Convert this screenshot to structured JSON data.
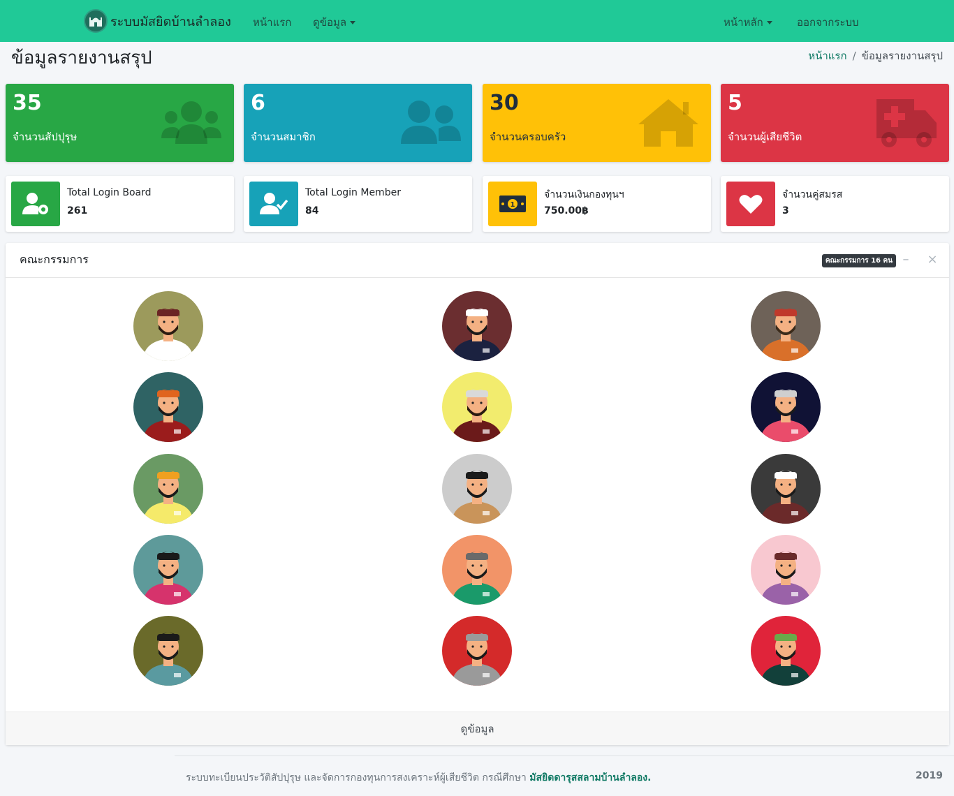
{
  "navbar": {
    "brand": "ระบบมัสยิดบ้านลำลอง",
    "links": [
      "หน้าแรก",
      "ดูข้อมูล"
    ],
    "right_links": [
      "หน้าหลัก",
      "ออกจากระบบ"
    ]
  },
  "page": {
    "title": "ข้อมูลรายงานสรุป",
    "breadcrumb": [
      "หน้าแรก",
      "ข้อมูลรายงานสรุป"
    ]
  },
  "small_boxes": [
    {
      "value": "35",
      "label": "จำนวนสัปปุรุษ",
      "color": "#28a745",
      "icon": "users-icon"
    },
    {
      "value": "6",
      "label": "จำนวนสมาชิก",
      "color": "#17a2b8",
      "icon": "user-friends-icon"
    },
    {
      "value": "30",
      "label": "จำนวนครอบครัว",
      "color": "#ffc107",
      "icon": "home-icon"
    },
    {
      "value": "5",
      "label": "จำนวนผู้เสียชีวิต",
      "color": "#dc3545",
      "icon": "ambulance-icon"
    }
  ],
  "info_boxes": [
    {
      "label": "Total Login Board",
      "value": "261",
      "color": "#28a745",
      "icon": "user-cog-icon"
    },
    {
      "label": "Total Login Member",
      "value": "84",
      "color": "#17a2b8",
      "icon": "user-check-icon"
    },
    {
      "label": "จำนวนเงินกองทุนฯ",
      "value": "750.00฿",
      "color": "#ffc107",
      "icon": "money-bill-icon"
    },
    {
      "label": "จำนวนคู่สมรส",
      "value": "3",
      "color": "#dc3545",
      "icon": "heart-icon"
    }
  ],
  "committee": {
    "title": "คณะกรรมการ",
    "badge": "คณะกรรมการ 16 คน",
    "footer_link": "ดูข้อมูล",
    "avatars": [
      {
        "bg": "#9c9a5c",
        "shirt": "#ffffff",
        "hat": "#6b2424",
        "hair": "#2a1a10"
      },
      {
        "bg": "#6b2e30",
        "shirt": "#1b2240",
        "hat": "#ffffff",
        "hair": "#1a1a1a"
      },
      {
        "bg": "#6e6258",
        "shirt": "#d9702a",
        "hat": "#c0392b",
        "hair": "#3a2a1a"
      },
      {
        "bg": "#2f6364",
        "shirt": "#9b1c1c",
        "hat": "#e0641e",
        "hair": "#1a1a1a"
      },
      {
        "bg": "#f2ec6e",
        "shirt": "#6b1a1a",
        "hat": "#d9d9d9",
        "hair": "#2a1a10"
      },
      {
        "bg": "#101235",
        "shirt": "#ea4c6b",
        "hat": "#cfcfcf",
        "hair": "#1a1a1a"
      },
      {
        "bg": "#6a9a64",
        "shirt": "#f5ea6a",
        "hat": "#f0a020",
        "hair": "#1a1a1a"
      },
      {
        "bg": "#cccccc",
        "shirt": "#c9945a",
        "hat": "#1a1a1a",
        "hair": "#1a1a1a"
      },
      {
        "bg": "#3a3a3a",
        "shirt": "#6b2a2a",
        "hat": "#ffffff",
        "hair": "#1a1a1a"
      },
      {
        "bg": "#5e9a9a",
        "shirt": "#d6336c",
        "hat": "#1a1a1a",
        "hair": "#1a1a1a"
      },
      {
        "bg": "#f29468",
        "shirt": "#1a9a6a",
        "hat": "#6a6a6a",
        "hair": "#1a1a1a"
      },
      {
        "bg": "#f8c8d0",
        "shirt": "#9a62a8",
        "hat": "#6a2a2a",
        "hair": "#1a1a1a"
      },
      {
        "bg": "#6a6a2a",
        "shirt": "#5a9aa0",
        "hat": "#1a1a1a",
        "hair": "#1a1a1a"
      },
      {
        "bg": "#d42a2a",
        "shirt": "#9a9a9a",
        "hat": "#9a9a9a",
        "hair": "#1a1a1a"
      },
      {
        "bg": "#e0243a",
        "shirt": "#12403a",
        "hat": "#6aaa4a",
        "hair": "#1a1a1a"
      }
    ]
  },
  "footer": {
    "text": "ระบบทะเบียนประวัติสัปปุรุษ และจัดการกองทุนการสงเคราะห์ผู้เสียชีวิต กรณีศึกษา ",
    "link": "มัสยิดดารุสสลามบ้านลำลอง.",
    "year": "2019"
  }
}
